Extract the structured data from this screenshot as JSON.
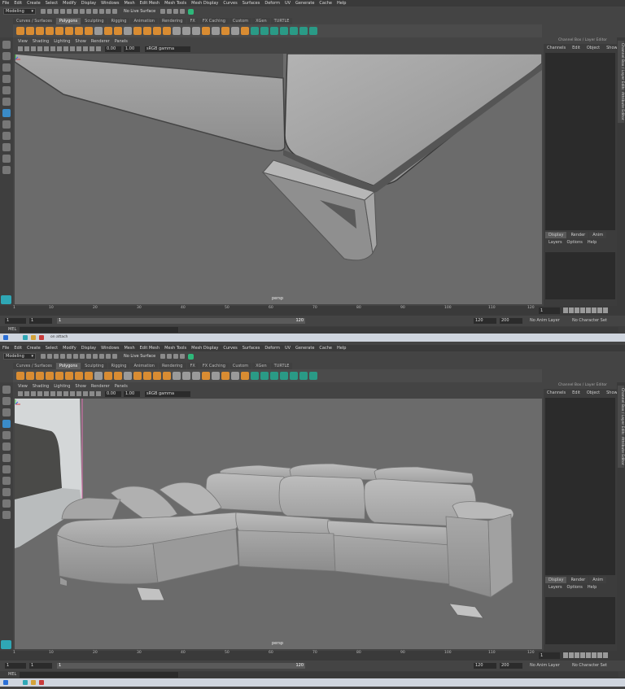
{
  "menus": [
    "File",
    "Edit",
    "Create",
    "Select",
    "Modify",
    "Display",
    "Windows",
    "Mesh",
    "Edit Mesh",
    "Mesh Tools",
    "Mesh Display",
    "Curves",
    "Surfaces",
    "Deform",
    "UV",
    "Generate",
    "Cache",
    "Help"
  ],
  "mode": "Modeling",
  "live_surface": "No Live Surface",
  "shelf_tabs": [
    "Curves / Surfaces",
    "Polygons",
    "Sculpting",
    "Rigging",
    "Animation",
    "Rendering",
    "FX",
    "FX Caching",
    "Custom",
    "XGen",
    "TURTLE"
  ],
  "active_shelf_tab": "Polygons",
  "panel_menu": [
    "View",
    "Shading",
    "Lighting",
    "Show",
    "Renderer",
    "Panels"
  ],
  "panel_bar": {
    "value1": "0.00",
    "value2": "1.00",
    "color_space": "sRGB gamma"
  },
  "camera": "persp",
  "channel_box": {
    "title": "Channel Box / Layer Editor",
    "menu": [
      "Channels",
      "Edit",
      "Object",
      "Show"
    ]
  },
  "layer_tabs": [
    "Display",
    "Render",
    "Anim"
  ],
  "layer_menu": [
    "Layers",
    "Options",
    "Help"
  ],
  "side_tabs": [
    "Channel Box / Layer Editor",
    "Attribute Editor"
  ],
  "timeline": {
    "ticks": [
      "1",
      "10",
      "20",
      "30",
      "40",
      "50",
      "60",
      "70",
      "80",
      "90",
      "100",
      "110",
      "120"
    ],
    "current_frame": "1"
  },
  "range": {
    "start": "1",
    "playback_start": "1",
    "slider_start": "1",
    "slider_end": "120",
    "playback_end": "120",
    "end": "200",
    "anim_layer": "No Anim Layer",
    "character_set": "No Character Set"
  },
  "cmd_label": "MEL",
  "taskbar_text": "on attach",
  "colors": {
    "maya_orange": "#d98c32",
    "maya_teal": "#2fa7b5",
    "viewport_bg": "#6b6b6b",
    "selection_blue": "#3a8bc8"
  }
}
